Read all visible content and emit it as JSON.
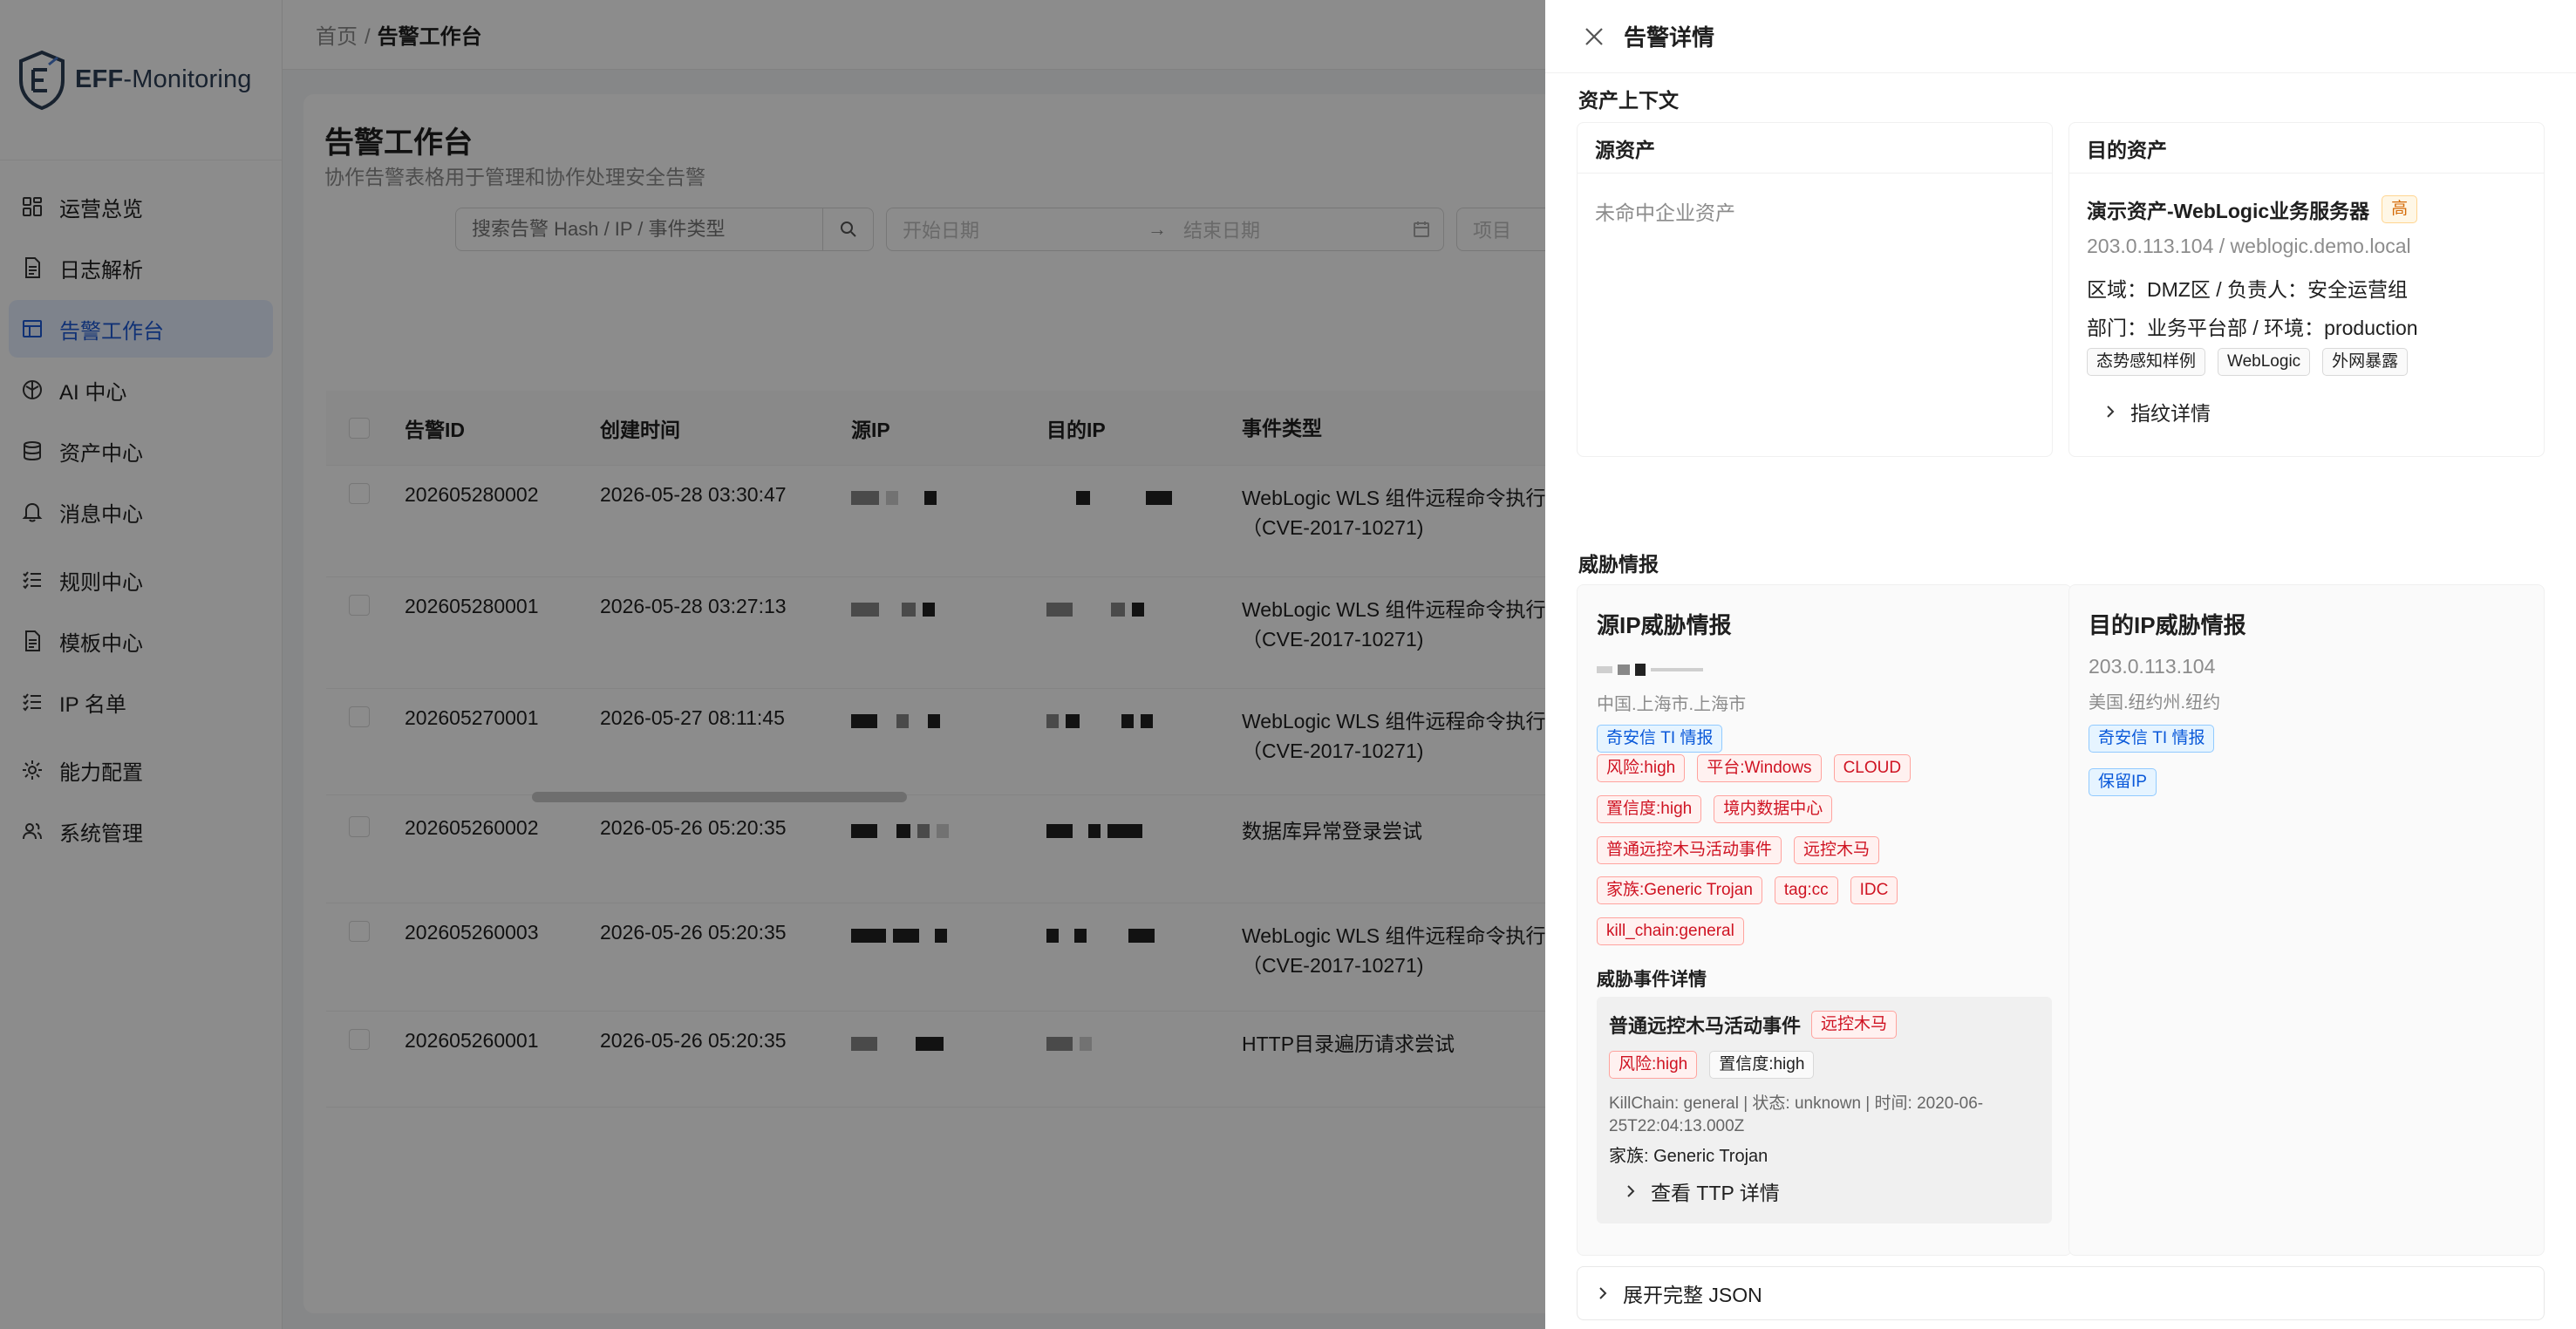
{
  "app": {
    "name_bold": "EFF",
    "name_rest": "-Monitoring"
  },
  "sidebar": {
    "items": [
      {
        "label": "运营总览",
        "icon": "dashboard-icon"
      },
      {
        "label": "日志解析",
        "icon": "document-icon"
      },
      {
        "label": "告警工作台",
        "icon": "table-icon",
        "active": true
      },
      {
        "label": "AI 中心",
        "icon": "ai-icon"
      },
      {
        "label": "资产中心",
        "icon": "database-icon"
      },
      {
        "label": "消息中心",
        "icon": "bell-icon"
      },
      {
        "label": "规则中心",
        "icon": "checklist-icon"
      },
      {
        "label": "模板中心",
        "icon": "document-icon"
      },
      {
        "label": "IP 名单",
        "icon": "checklist-icon"
      },
      {
        "label": "能力配置",
        "icon": "gear-icon"
      },
      {
        "label": "系统管理",
        "icon": "users-icon"
      }
    ]
  },
  "breadcrumb": {
    "home": "首页",
    "sep": "/",
    "current": "告警工作台"
  },
  "page": {
    "title": "告警工作台",
    "subtitle": "协作告警表格用于管理和协作处理安全告警",
    "search_placeholder": "搜索告警 Hash / IP / 事件类型",
    "start_date_placeholder": "开始日期",
    "end_date_placeholder": "结束日期",
    "project_placeholder": "项目"
  },
  "table": {
    "headers": {
      "id": "告警ID",
      "time": "创建时间",
      "src": "源IP",
      "dst": "目的IP",
      "type": "事件类型"
    },
    "rows": [
      {
        "id": "202605280002",
        "time": "2026-05-28 03:30:47",
        "type": "WebLogic WLS 组件远程命令执行",
        "type2": "（CVE-2017-10271)"
      },
      {
        "id": "202605280001",
        "time": "2026-05-28 03:27:13",
        "type": "WebLogic WLS 组件远程命令执行",
        "type2": "（CVE-2017-10271)"
      },
      {
        "id": "202605270001",
        "time": "2026-05-27 08:11:45",
        "type": "WebLogic WLS 组件远程命令执行",
        "type2": "（CVE-2017-10271)"
      },
      {
        "id": "202605260002",
        "time": "2026-05-26 05:20:35",
        "type": "数据库异常登录尝试",
        "type2": ""
      },
      {
        "id": "202605260003",
        "time": "2026-05-26 05:20:35",
        "type": "WebLogic WLS 组件远程命令执行",
        "type2": "（CVE-2017-10271)"
      },
      {
        "id": "202605260001",
        "time": "2026-05-26 05:20:35",
        "type": "HTTP目录遍历请求尝试",
        "type2": ""
      }
    ]
  },
  "drawer": {
    "title": "告警详情",
    "asset_section": "资产上下文",
    "src_asset": {
      "title": "源资产",
      "empty": "未命中企业资产"
    },
    "dst_asset": {
      "title": "目的资产",
      "name": "演示资产-WebLogic业务服务器",
      "level": "高",
      "address": "203.0.113.104 / weblogic.demo.local",
      "zone": "区域：DMZ区 / 负责人：安全运营组",
      "dept": "部门：业务平台部 / 环境：production",
      "tags": [
        "态势感知样例",
        "WebLogic",
        "外网暴露"
      ],
      "fingerprint": "指纹详情"
    },
    "threat_section": "威胁情报",
    "src_ti": {
      "title": "源IP威胁情报",
      "location": "中国.上海市.上海市",
      "source_tag": "奇安信 TI 情报",
      "tag_rows": [
        [
          "风险:high",
          "平台:Windows",
          "CLOUD"
        ],
        [
          "置信度:high",
          "境内数据中心"
        ],
        [
          "普通远控木马活动事件",
          "远控木马"
        ],
        [
          "家族:Generic Trojan",
          "tag:cc",
          "IDC"
        ],
        [
          "kill_chain:general"
        ]
      ],
      "event_heading": "威胁事件详情",
      "event": {
        "title": "普通远控木马活动事件",
        "category": "远控木马",
        "tags": [
          "风险:high",
          "置信度:high"
        ],
        "meta1": "KillChain: general | 状态: unknown | 时间: 2020-06-",
        "meta2": "25T22:04:13.000Z",
        "family": "家族: Generic Trojan",
        "ttp": "查看 TTP 详情"
      }
    },
    "dst_ti": {
      "title": "目的IP威胁情报",
      "ip": "203.0.113.104",
      "location": "美国.纽约州.纽约",
      "source_tag": "奇安信 TI 情报",
      "reserved_tag": "保留IP"
    },
    "json_toggle": "展开完整 JSON"
  },
  "colors": {
    "accent": "#1e5ad6",
    "active_bg": "#e6efff",
    "danger": "#cf1322",
    "mask": "rgba(0,0,0,0.45)"
  }
}
